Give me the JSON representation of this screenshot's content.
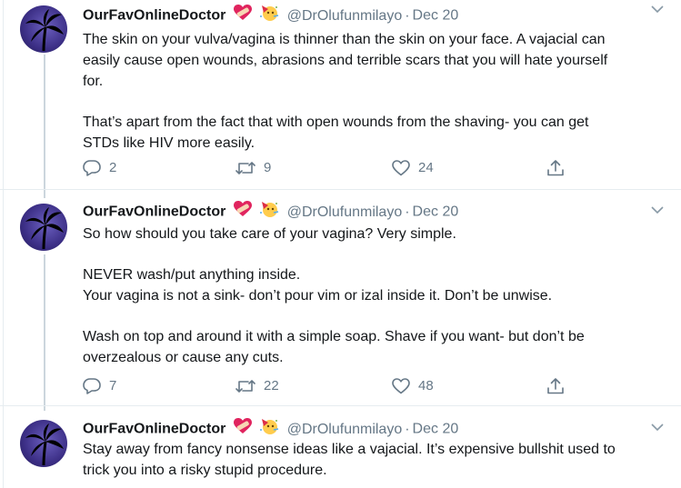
{
  "tweets": [
    {
      "display_name": "OurFavOnlineDoctor",
      "handle": "@DrOlufunmilayo",
      "separator": "·",
      "date": "Dec 20",
      "lines": [
        "The skin on your vulva/vagina is thinner than the skin on your face. A vajacial can",
        "easily cause open wounds, abrasions and terrible scars that you will hate yourself",
        "for.",
        "",
        "That’s apart from the fact that with open wounds from the shaving- you can get",
        "STDs like HIV more easily."
      ],
      "replies": "2",
      "retweets": "9",
      "likes": "24"
    },
    {
      "display_name": "OurFavOnlineDoctor",
      "handle": "@DrOlufunmilayo",
      "separator": "·",
      "date": "Dec 20",
      "lines": [
        "So how should you take care of your vagina? Very simple.",
        "",
        "NEVER wash/put anything inside.",
        "Your vagina is not a sink- don’t pour vim or izal inside it. Don’t be unwise.",
        "",
        "Wash on top and around it with a simple soap. Shave if you want- but don’t be",
        "overzealous or cause any cuts."
      ],
      "replies": "7",
      "retweets": "22",
      "likes": "48"
    },
    {
      "display_name": "OurFavOnlineDoctor",
      "handle": "@DrOlufunmilayo",
      "separator": "·",
      "date": "Dec 20",
      "lines": [
        "Stay away from fancy nonsense ideas like a vajacial. It’s expensive bullshit used to",
        "trick you into a risky stupid procedure."
      ]
    }
  ],
  "icons": {
    "name_emojis": [
      "heart-with-bandage-icon",
      "party-face-icon"
    ],
    "caret": "chevron-down-icon",
    "reply": "reply-icon",
    "retweet": "retweet-icon",
    "like": "heart-icon",
    "share": "share-icon"
  },
  "colors": {
    "text": "#14171a",
    "secondary": "#657786",
    "divider": "#e6ecf0",
    "avatar": "#3c2f86",
    "heart_emoji": "#e0245e",
    "party_emoji": "#ffcc4d"
  }
}
